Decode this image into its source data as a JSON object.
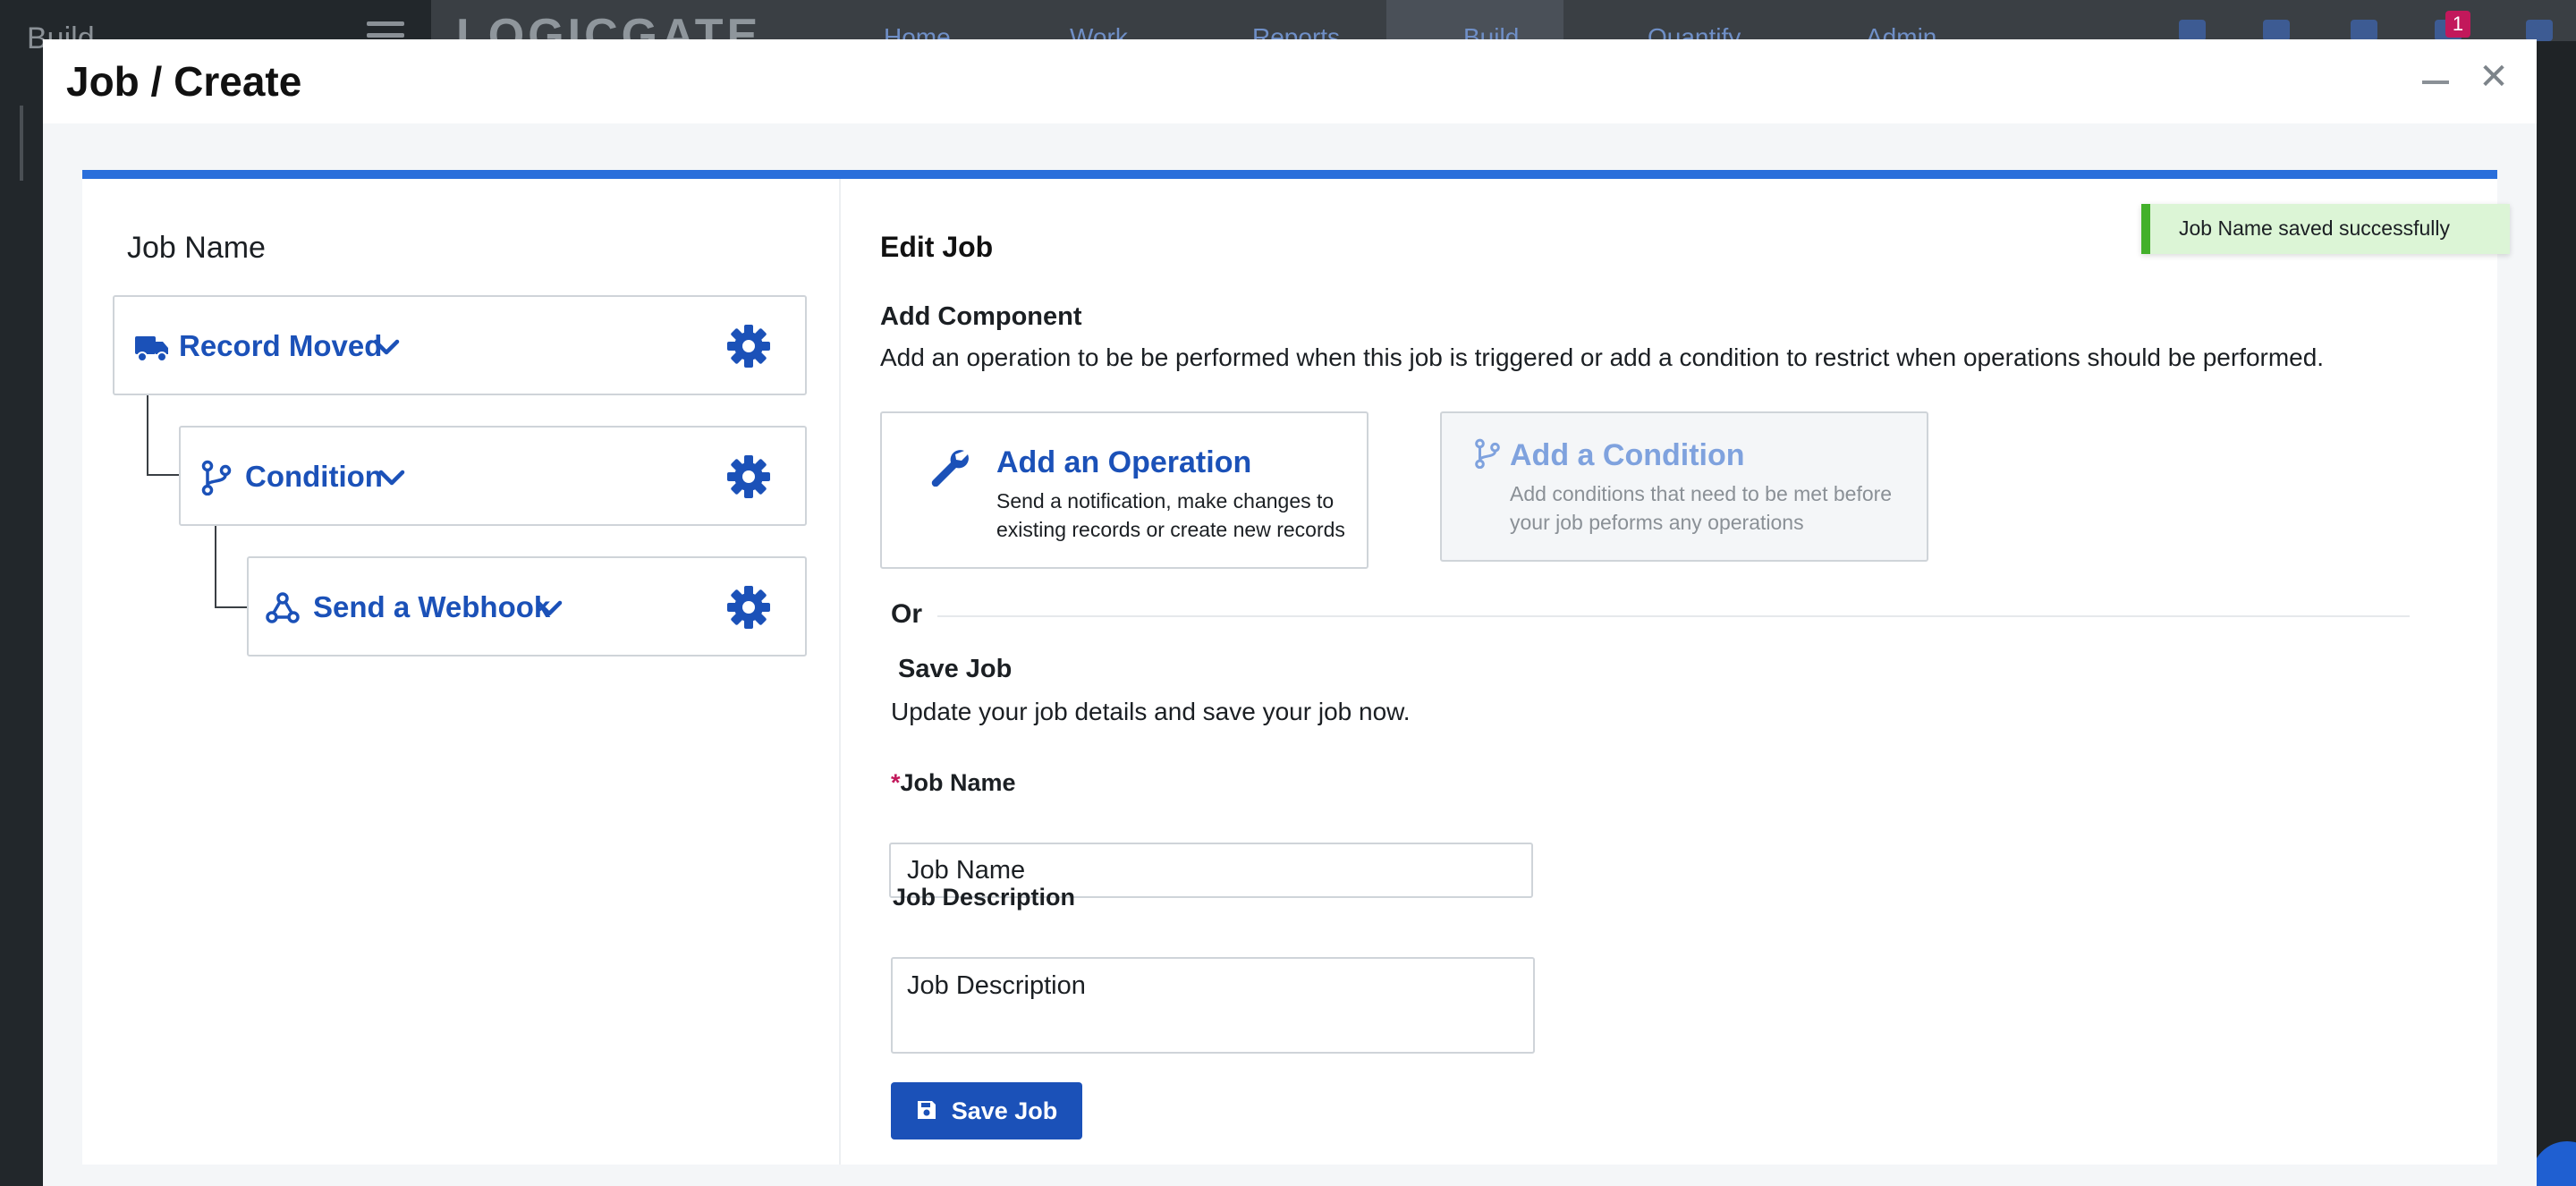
{
  "background": {
    "sidebar_title": "Build",
    "logo": "LOGICGATE",
    "nav": [
      "Home",
      "Work",
      "Reports",
      "Build",
      "Quantify",
      "Admin"
    ],
    "notification_count": "1"
  },
  "modal": {
    "title": "Job / Create"
  },
  "tree": {
    "title": "Job Name",
    "nodes": [
      {
        "label": "Record Moved",
        "icon": "truck-icon"
      },
      {
        "label": "Condition",
        "icon": "branch-icon"
      },
      {
        "label": "Send a Webhook",
        "icon": "webhook-icon"
      }
    ]
  },
  "edit": {
    "title": "Edit Job",
    "add_component_title": "Add Component",
    "add_component_desc": "Add an operation to be be performed when this job is triggered or add a condition to restrict when operations should be performed.",
    "operation": {
      "title": "Add an Operation",
      "desc": "Send a notification, make changes to existing records or create new records"
    },
    "condition": {
      "title": "Add a Condition",
      "desc": "Add conditions that need to be met before your job peforms any operations"
    },
    "or_label": "Or",
    "save_title": "Save Job",
    "save_desc": "Update your job details and save your job now.",
    "job_name_label": "Job Name",
    "job_name_required": "*",
    "job_name_value": "Job Name",
    "job_desc_label": "Job Description",
    "job_desc_value": "Job Description",
    "save_button": "Save Job"
  },
  "toast": {
    "message": "Job Name saved successfully"
  },
  "colors": {
    "accent": "#1b51b8",
    "top_bar": "#2a6fdb",
    "toast_bg": "#dcf5d6",
    "toast_border": "#43b02a",
    "required": "#c2185b"
  }
}
